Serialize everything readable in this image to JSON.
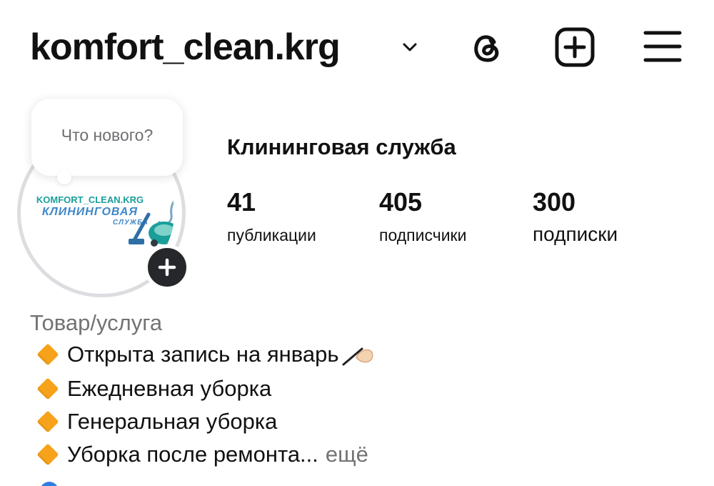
{
  "header": {
    "username": "komfort_clean.krg",
    "icons": [
      "chevron-down-icon",
      "threads-icon",
      "create-icon",
      "menu-icon"
    ]
  },
  "avatar": {
    "logo_line1": "KOMFORT_CLEAN.KRG",
    "logo_line2": "КЛИНИНГОВАЯ",
    "logo_line3": "СЛУЖБА",
    "note_placeholder": "Что нового?"
  },
  "profile": {
    "name": "Клининговая служба",
    "stats": [
      {
        "value": "41",
        "label": "публикации"
      },
      {
        "value": "405",
        "label": "подписчики"
      },
      {
        "value": "300",
        "label": "подписки"
      }
    ]
  },
  "bio": {
    "category": "Товар/услуга",
    "lines": [
      "Открыта запись на январь",
      "Ежедневная уборка",
      "Генеральная уборка",
      "Уборка после ремонта..."
    ],
    "more": "ещё"
  },
  "colors": {
    "accent_diamond": "#f7a21b",
    "logo_teal": "#1a9f9a",
    "logo_blue": "#3f86c8",
    "muted_text": "#737373"
  }
}
